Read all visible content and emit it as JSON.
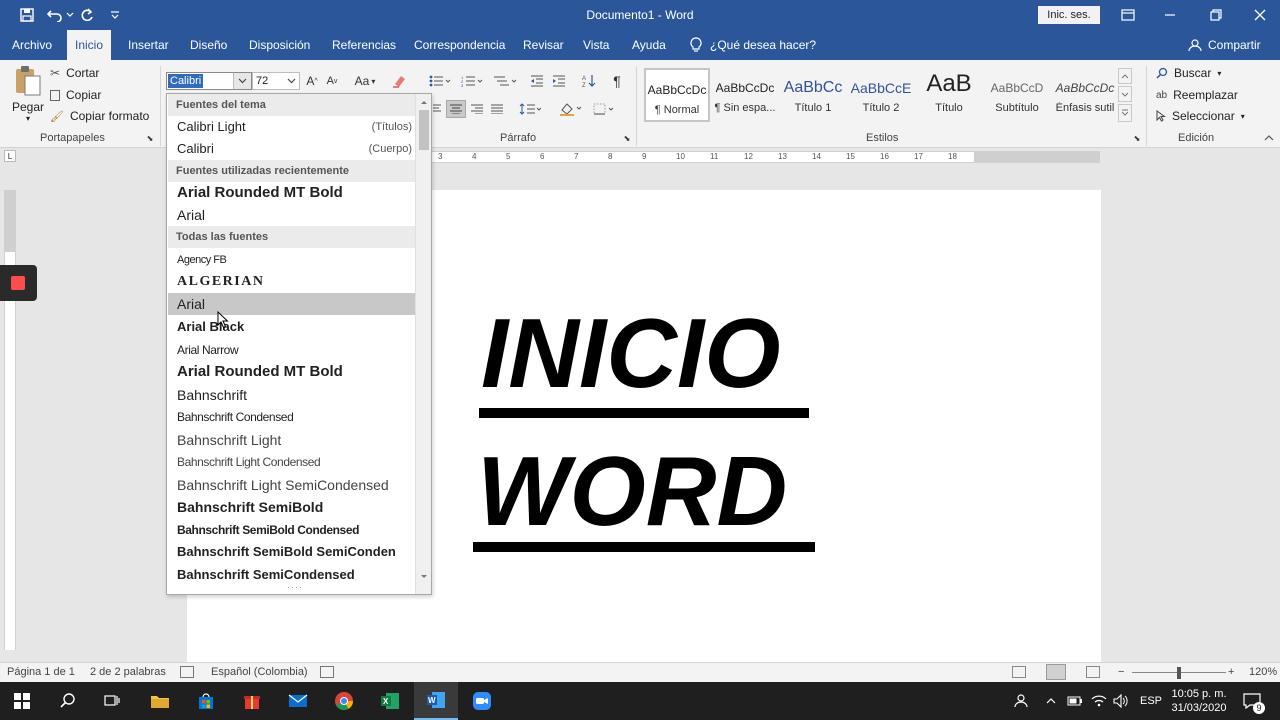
{
  "window": {
    "title": "Documento1  -  Word",
    "signin_label": "Inic. ses."
  },
  "colors": {
    "accent": "#2b579a",
    "selection": "#2f6bc1",
    "highlight_row": "#c8c8c8"
  },
  "tabs": [
    {
      "label": "Archivo"
    },
    {
      "label": "Inicio"
    },
    {
      "label": "Insertar"
    },
    {
      "label": "Diseño"
    },
    {
      "label": "Disposición"
    },
    {
      "label": "Referencias"
    },
    {
      "label": "Correspondencia"
    },
    {
      "label": "Revisar"
    },
    {
      "label": "Vista"
    },
    {
      "label": "Ayuda"
    }
  ],
  "active_tab": "Inicio",
  "tellme": "¿Qué desea hacer?",
  "share_label": "Compartir",
  "clipboard": {
    "paste": "Pegar",
    "cut": "Cortar",
    "copy": "Copiar",
    "format_painter": "Copiar formato",
    "group": "Portapapeles"
  },
  "font": {
    "name_value": "Calibri",
    "size_value": "72",
    "case_label": "Aa"
  },
  "paragraph": {
    "group": "Párrafo"
  },
  "styles": {
    "group": "Estilos",
    "items": [
      {
        "preview": "AaBbCcDc",
        "name": "¶ Normal"
      },
      {
        "preview": "AaBbCcDc",
        "name": "¶ Sin espa..."
      },
      {
        "preview": "AaBbCc",
        "name": "Título 1"
      },
      {
        "preview": "AaBbCcE",
        "name": "Título 2"
      },
      {
        "preview": "AaB",
        "name": "Título"
      },
      {
        "preview": "AaBbCcD",
        "name": "Subtítulo"
      },
      {
        "preview": "AaBbCcDc",
        "name": "Énfasis sutil"
      }
    ]
  },
  "editing": {
    "find": "Buscar",
    "replace": "Reemplazar",
    "select": "Seleccionar",
    "group": "Edición"
  },
  "font_dropdown": {
    "theme_header": "Fuentes del tema",
    "theme_fonts": [
      {
        "name": "Calibri Light",
        "tag": "(Títulos)"
      },
      {
        "name": "Calibri",
        "tag": "(Cuerpo)"
      }
    ],
    "recent_header": "Fuentes utilizadas recientemente",
    "recent_fonts": [
      "Arial Rounded MT Bold",
      "Arial"
    ],
    "all_header": "Todas las fuentes",
    "all_fonts": [
      "Agency FB",
      "ALGERIAN",
      "Arial",
      "Arial Black",
      "Arial Narrow",
      "Arial Rounded MT Bold",
      "Bahnschrift",
      "Bahnschrift Condensed",
      "Bahnschrift Light",
      "Bahnschrift Light Condensed",
      "Bahnschrift Light SemiCondensed",
      "Bahnschrift SemiBold",
      "Bahnschrift SemiBold Condensed",
      "Bahnschrift SemiBold SemiConden",
      "Bahnschrift SemiCondensed"
    ],
    "hovered": "Arial"
  },
  "ruler": {
    "ticks": [
      "3",
      "4",
      "5",
      "6",
      "7",
      "8",
      "9",
      "10",
      "11",
      "12",
      "13",
      "14",
      "15",
      "16",
      "17",
      "18"
    ]
  },
  "document": {
    "line1": "INICIO",
    "line2": "WORD"
  },
  "status": {
    "page": "Página 1 de 1",
    "words": "2 de 2 palabras",
    "language": "Español (Colombia)",
    "zoom": "120%"
  },
  "taskbar": {
    "lang": "ESP",
    "time": "10:05 p. m.",
    "date": "31/03/2020",
    "notifications": "9"
  }
}
